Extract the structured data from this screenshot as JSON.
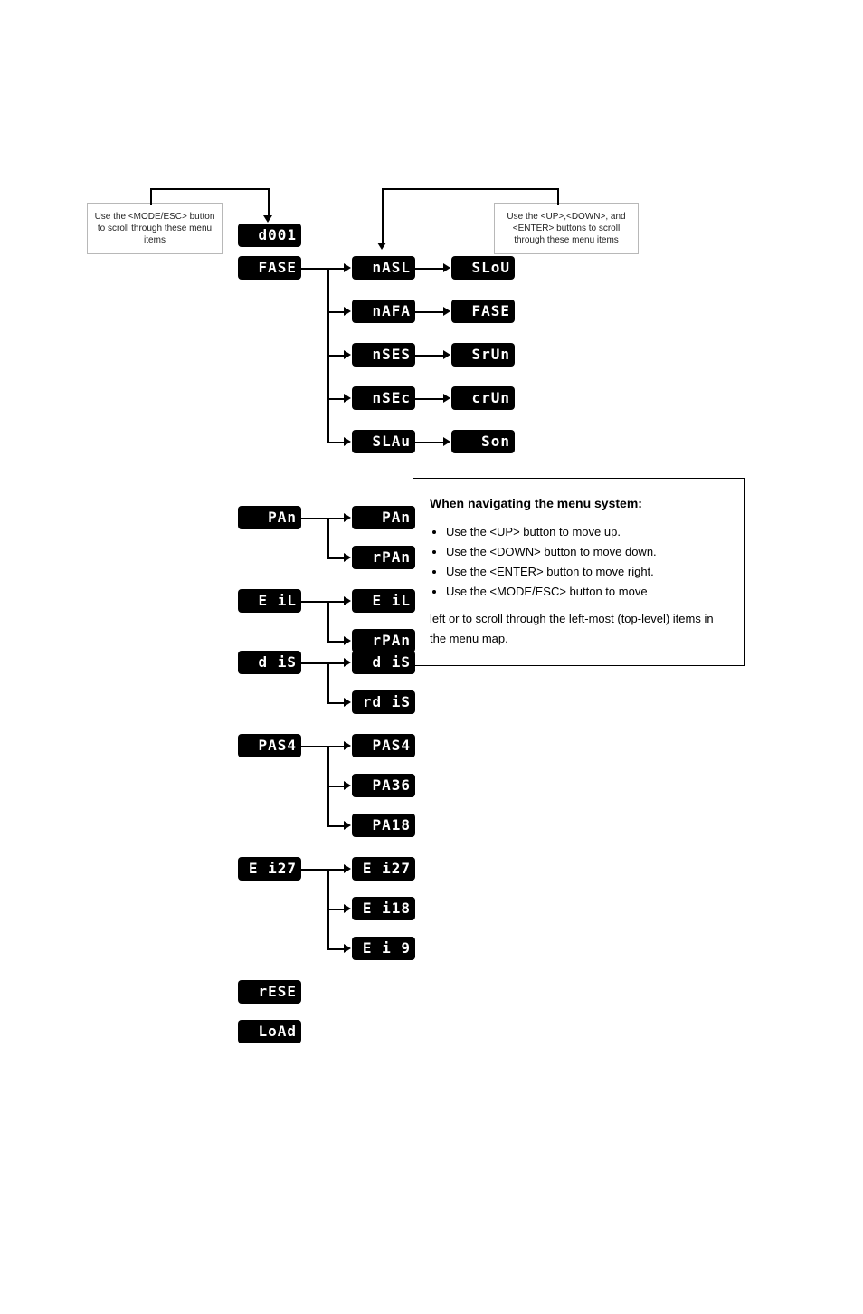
{
  "note_left": "Use the <MODE/ESC> button to scroll through these menu items",
  "note_right": "Use the <UP>,<DOWN>, and <ENTER> buttons to scroll through these menu items",
  "info": {
    "heading": "When navigating the menu system:",
    "b1": "Use the <UP> button to move up.",
    "b2": "Use the <DOWN> button to move down.",
    "b3": "Use the <ENTER> button to move right.",
    "b4": "Use the <MODE/ESC> button to move",
    "tail": " left or to scroll through the left-most (top-level) items in the menu map."
  },
  "col1": {
    "d001": "d001",
    "FASt": "FASE",
    "PAn": " PAn",
    "tiL": " E iL",
    "diS": " d iS",
    "PAS4": "PAS4",
    "ti27": "E i27",
    "rESt": "rESE",
    "LoAd": "LoAd"
  },
  "col2": {
    "NASL": "nASL",
    "NAFA": "nAFA",
    "NStS": "nSES",
    "NStc": "nSEc",
    "SLAu": "SLAu",
    "PAn": " PAn",
    "rPAn": "rPAn",
    "tiL": " E iL",
    "rPAn2": "rPAn",
    "diS": " d iS",
    "rdiS": "rd iS",
    "PAS4": "PAS4",
    "PA36": "PA36",
    "PA18": "PA18",
    "ti27": "E i27",
    "ti18": "E i18",
    "ti9": "E i 9"
  },
  "col3": {
    "SLoU": "SLoU",
    "FASt": "FASE",
    "SrUn": "SrUn",
    "crUn": "crUn",
    "Son": " Son"
  }
}
